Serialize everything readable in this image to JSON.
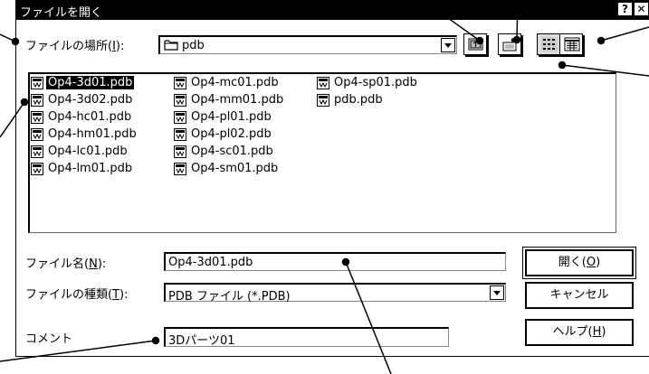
{
  "window": {
    "title": "ファイルを開く",
    "help_glyph": "?",
    "close_glyph": "✕"
  },
  "lookin": {
    "label": "ファイルの場所(",
    "accel": "I",
    "label_end": "):",
    "value": "pdb"
  },
  "toolbar": {
    "icons": [
      "up-one-level-icon",
      "create-new-folder-icon",
      "list-view-icon",
      "details-view-icon"
    ]
  },
  "files": [
    {
      "name": "Op4-3d01.pdb",
      "selected": true
    },
    {
      "name": "Op4-3d02.pdb"
    },
    {
      "name": "Op4-hc01.pdb"
    },
    {
      "name": "Op4-hm01.pdb"
    },
    {
      "name": "Op4-lc01.pdb"
    },
    {
      "name": "Op4-lm01.pdb"
    },
    {
      "name": "Op4-mc01.pdb"
    },
    {
      "name": "Op4-mm01.pdb"
    },
    {
      "name": "Op4-pl01.pdb"
    },
    {
      "name": "Op4-pl02.pdb"
    },
    {
      "name": "Op4-sc01.pdb"
    },
    {
      "name": "Op4-sm01.pdb"
    },
    {
      "name": "Op4-sp01.pdb"
    },
    {
      "name": "pdb.pdb"
    }
  ],
  "filename": {
    "label": "ファイル名(",
    "accel": "N",
    "label_end": "):",
    "value": "Op4-3d01.pdb"
  },
  "filetype": {
    "label": "ファイルの種類(",
    "accel": "T",
    "label_end": "):",
    "value": "PDB ファイル (*.PDB)"
  },
  "comment": {
    "label": "コメント",
    "value": "3Dパーツ01"
  },
  "buttons": {
    "open": {
      "label": "開く(",
      "accel": "O",
      "end": ")"
    },
    "cancel": {
      "label": "キャンセル"
    },
    "help": {
      "label": "ヘルプ(",
      "accel": "H",
      "end": ")"
    }
  }
}
